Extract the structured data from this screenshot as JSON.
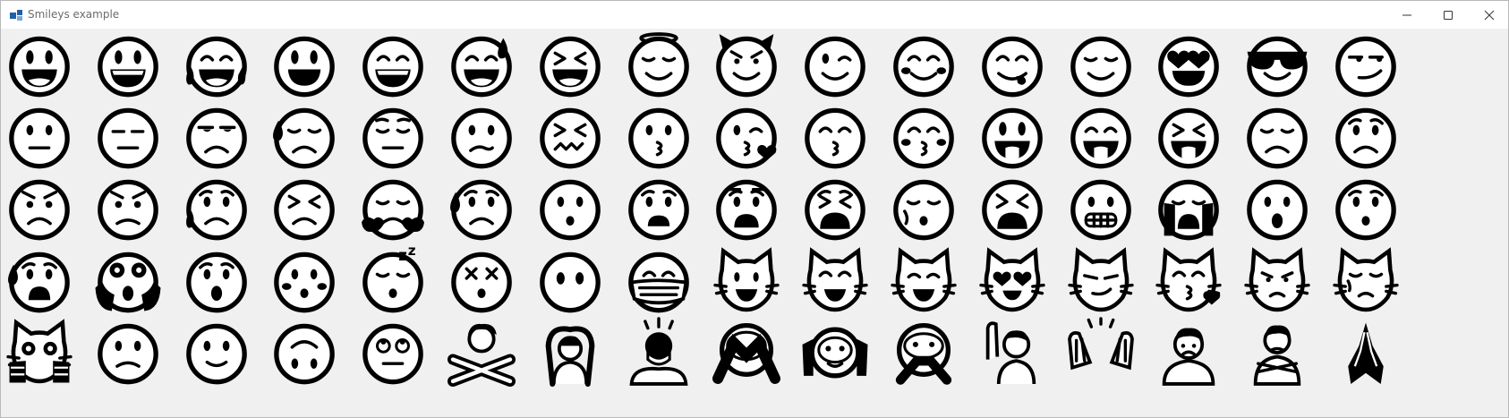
{
  "window": {
    "title": "Smileys example",
    "controls": [
      "minimize",
      "maximize",
      "close"
    ]
  },
  "emoji_grid": {
    "rows": [
      [
        "grinning-face",
        "grinning-face-big-eyes",
        "rolling-laughing-face",
        "smiling-face-big-eyes",
        "beaming-face",
        "grinning-sweat-face",
        "squinting-face",
        "smiling-face-halo",
        "smiling-face-horns",
        "winking-face",
        "smiling-face-smiling-eyes",
        "face-savoring-food",
        "relieved-face",
        "smiling-face-heart-eyes",
        "smiling-face-sunglasses",
        "smirking-face"
      ],
      [
        "neutral-face",
        "expressionless-face",
        "unamused-face",
        "downcast-sweat-face",
        "pensive-face",
        "confused-face",
        "confounded-face",
        "kissing-face",
        "face-blowing-kiss",
        "kissing-smiling-eyes",
        "kissing-closed-eyes",
        "face-with-tongue",
        "winking-tongue-face",
        "squinting-tongue-face",
        "disappointed-face",
        "worried-face"
      ],
      [
        "angry-face",
        "pouting-face",
        "crying-face",
        "persevering-face",
        "face-with-steam",
        "sad-relieved-face",
        "frowning-open-mouth",
        "anguished-face",
        "fearful-face",
        "weary-face",
        "sleepy-face",
        "tired-face",
        "grimacing-face",
        "loudly-crying-face",
        "face-open-mouth",
        "hushed-face"
      ],
      [
        "anxious-sweat-face",
        "face-screaming-fear",
        "astonished-face",
        "flushed-face",
        "sleeping-face",
        "dizzy-face",
        "face-without-mouth",
        "face-with-medical-mask",
        "grinning-cat",
        "grinning-cat-smiling-eyes",
        "cat-tears-of-joy",
        "smiling-cat-heart-eyes",
        "cat-wry-smile",
        "kissing-cat",
        "pouting-cat",
        "crying-cat"
      ],
      [
        "weary-cat",
        "slightly-frowning-face",
        "slightly-smiling-face",
        "upside-down-face",
        "face-rolling-eyes",
        "person-gesturing-no",
        "person-gesturing-ok",
        "person-bowing",
        "see-no-evil-monkey",
        "hear-no-evil-monkey",
        "speak-no-evil-monkey",
        "person-raising-hand",
        "person-raising-both-hands",
        "person-frowning",
        "person-pouting",
        "folded-hands"
      ]
    ]
  }
}
